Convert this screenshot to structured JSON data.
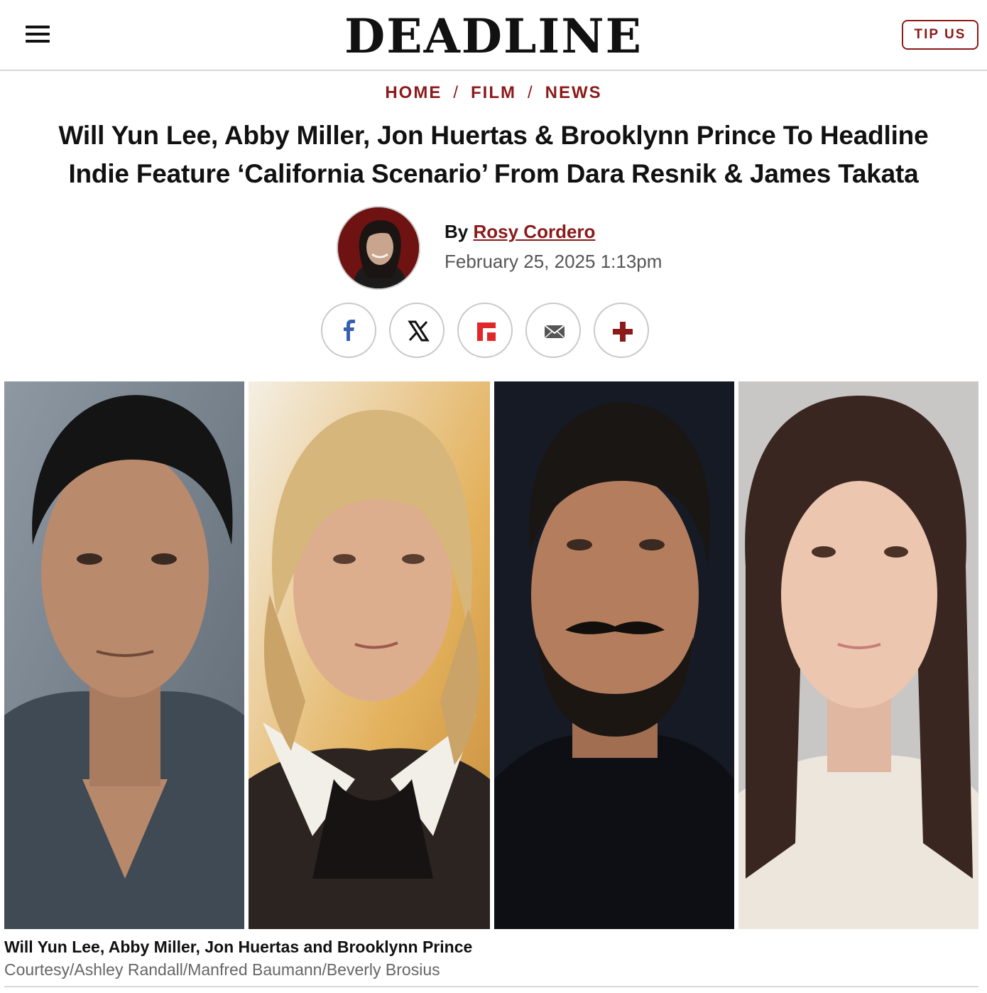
{
  "site": {
    "logo_text": "DEADLINE",
    "tip_button": "TIP US",
    "brand_color": "#8b1a1a"
  },
  "breadcrumb": {
    "items": [
      "HOME",
      "FILM",
      "NEWS"
    ],
    "separator": "/"
  },
  "article": {
    "headline_line1": "Will Yun Lee, Abby Miller, Jon Huertas & Brooklynn Prince To Headline",
    "headline_line2": "Indie Feature ‘California Scenario’ From Dara Resnik & James Takata",
    "by_prefix": "By",
    "author": "Rosy Cordero",
    "date": "February 25, 2025 1:13pm"
  },
  "share": {
    "buttons": [
      {
        "icon": "facebook-icon",
        "color": "#3b5fb0"
      },
      {
        "icon": "x-icon",
        "color": "#111111"
      },
      {
        "icon": "flipboard-icon",
        "color": "#e12828"
      },
      {
        "icon": "email-icon",
        "color": "#555555"
      },
      {
        "icon": "plus-icon",
        "color": "#8b1a1a"
      }
    ]
  },
  "photo": {
    "caption": "Will Yun Lee, Abby Miller, Jon Huertas and Brooklynn Prince",
    "credit": "Courtesy/Ashley Randall/Manfred Baumann/Beverly Brosius"
  }
}
